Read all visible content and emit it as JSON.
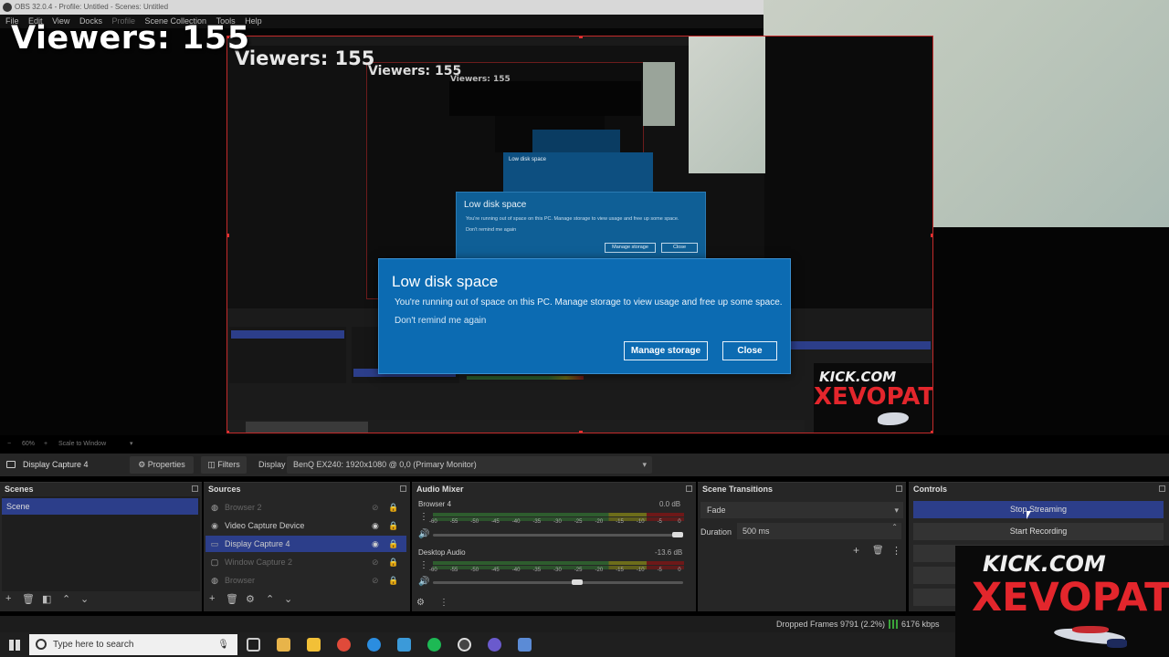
{
  "window": {
    "title": "OBS 32.0.4 - Profile: Untitled - Scenes: Untitled"
  },
  "menu": {
    "items": [
      "File",
      "Edit",
      "View",
      "Docks",
      "Profile",
      "Scene Collection",
      "Tools",
      "Help"
    ]
  },
  "overlay": {
    "viewers": "Viewers: 155",
    "kick_line1": "KICK.COM",
    "kick_line2": "XEVOPAT"
  },
  "dialog": {
    "title": "Low disk space",
    "message": "You're running out of space on this PC. Manage storage to view usage and free up some space.",
    "remind": "Don't remind me again",
    "manage_button": "Manage storage",
    "close_button": "Close"
  },
  "zoom": {
    "level": "60%",
    "mode": "Scale to Window"
  },
  "toolbar": {
    "source_name": "Display Capture 4",
    "properties": "Properties",
    "filters": "Filters",
    "display_label": "Display",
    "display_value": "BenQ EX240: 1920x1080 @ 0,0 (Primary Monitor)"
  },
  "scenes": {
    "header": "Scenes",
    "items": [
      "Scene"
    ]
  },
  "sources": {
    "header": "Sources",
    "items": [
      {
        "name": "Browser 2",
        "visible": false
      },
      {
        "name": "Video Capture Device",
        "visible": true
      },
      {
        "name": "Display Capture 4",
        "visible": true,
        "selected": true
      },
      {
        "name": "Window Capture 2",
        "visible": false
      },
      {
        "name": "Browser",
        "visible": false
      }
    ]
  },
  "audio": {
    "header": "Audio Mixer",
    "channels": [
      {
        "name": "Browser 4",
        "db": "0.0 dB"
      },
      {
        "name": "Desktop Audio",
        "db": "-13.6 dB"
      }
    ],
    "ticks": [
      "-60",
      "-55",
      "-50",
      "-45",
      "-40",
      "-35",
      "-30",
      "-25",
      "-20",
      "-15",
      "-10",
      "-5",
      "0"
    ]
  },
  "transitions": {
    "header": "Scene Transitions",
    "selected": "Fade",
    "duration_label": "Duration",
    "duration_value": "500 ms"
  },
  "controls": {
    "header": "Controls",
    "stop_streaming": "Stop Streaming",
    "start_recording": "Start Recording"
  },
  "status": {
    "dropped_frames": "Dropped Frames 9791 (2.2%)",
    "bitrate": "6176 kbps"
  },
  "taskbar": {
    "search_placeholder": "Type here to search"
  },
  "colors": {
    "dialog_blue": "#0c6bb2",
    "selection": "#2c3e8a",
    "kick_red": "#e3262c"
  }
}
